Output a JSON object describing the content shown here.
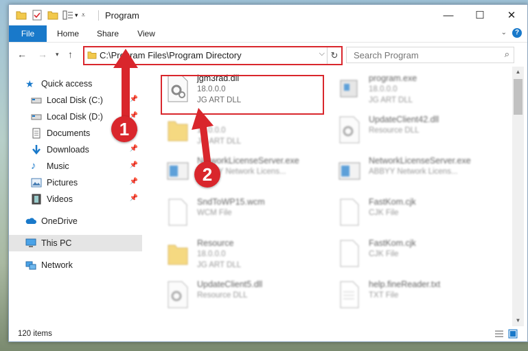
{
  "window": {
    "title": "Program"
  },
  "window_controls": {
    "minimize": "—",
    "maximize": "☐",
    "close": "✕"
  },
  "ribbon": {
    "tabs": [
      "File",
      "Home",
      "Share",
      "View"
    ],
    "help": "?"
  },
  "navigation": {
    "address": "C:\\Program Files\\Program Directory",
    "search_placeholder": "Search Program"
  },
  "sidebar": {
    "items": [
      {
        "label": "Quick access",
        "icon": "star-icon"
      },
      {
        "label": "Local Disk (C:)",
        "icon": "drive-icon",
        "pinned": true
      },
      {
        "label": "Local Disk (D:)",
        "icon": "drive-icon",
        "pinned": true
      },
      {
        "label": "Documents",
        "icon": "documents-icon",
        "pinned": true
      },
      {
        "label": "Downloads",
        "icon": "download-icon",
        "pinned": true
      },
      {
        "label": "Music",
        "icon": "music-icon",
        "pinned": true
      },
      {
        "label": "Pictures",
        "icon": "pictures-icon",
        "pinned": true
      },
      {
        "label": "Videos",
        "icon": "videos-icon",
        "pinned": true
      },
      {
        "label": "OneDrive",
        "icon": "cloud-icon"
      },
      {
        "label": "This PC",
        "icon": "computer-icon",
        "selected": true
      },
      {
        "label": "Network",
        "icon": "network-icon"
      }
    ]
  },
  "files": [
    {
      "name": "jgm3rad.dll",
      "line1": "18.0.0.0",
      "line2": "JG ART DLL",
      "icon": "dll-gear-icon"
    },
    {
      "name": "program.exe",
      "line1": "18.0.0.0",
      "line2": "JG ART DLL",
      "icon": "exe-icon"
    },
    {
      "name": "",
      "line1": "18.0.0.0",
      "line2": "JG ART DLL",
      "icon": "folder-icon"
    },
    {
      "name": "UpdateClient42.dll",
      "line1": "Resource DLL",
      "line2": "",
      "icon": "dll-gear-icon"
    },
    {
      "name": "NetworkLicenseServer.exe",
      "line1": "ABBYY Network Licens...",
      "line2": "",
      "icon": "window-icon"
    },
    {
      "name": "NetworkLicenseServer.exe",
      "line1": "ABBYY Network Licens...",
      "line2": "",
      "icon": "window-icon"
    },
    {
      "name": "SndToWP15.wcm",
      "line1": "WCM File",
      "line2": "",
      "icon": "file-icon"
    },
    {
      "name": "FastKom.cjk",
      "line1": "CJK File",
      "line2": "",
      "icon": "file-icon"
    },
    {
      "name": "Resource",
      "line1": "18.0.0.0",
      "line2": "JG ART DLL",
      "icon": "folder-icon"
    },
    {
      "name": "FastKom.cjk",
      "line1": "CJK File",
      "line2": "",
      "icon": "file-icon"
    },
    {
      "name": "UpdateClient5.dll",
      "line1": "Resource DLL",
      "line2": "",
      "icon": "dll-gear-icon"
    },
    {
      "name": "help.fineReader.txt",
      "line1": "TXT File",
      "line2": "",
      "icon": "text-file-icon"
    }
  ],
  "status": {
    "item_count": "120 items"
  },
  "annotations": {
    "step1": "1",
    "step2": "2",
    "color": "#d9262c"
  },
  "colors": {
    "accent": "#1979ca",
    "highlight": "#d9262c"
  }
}
